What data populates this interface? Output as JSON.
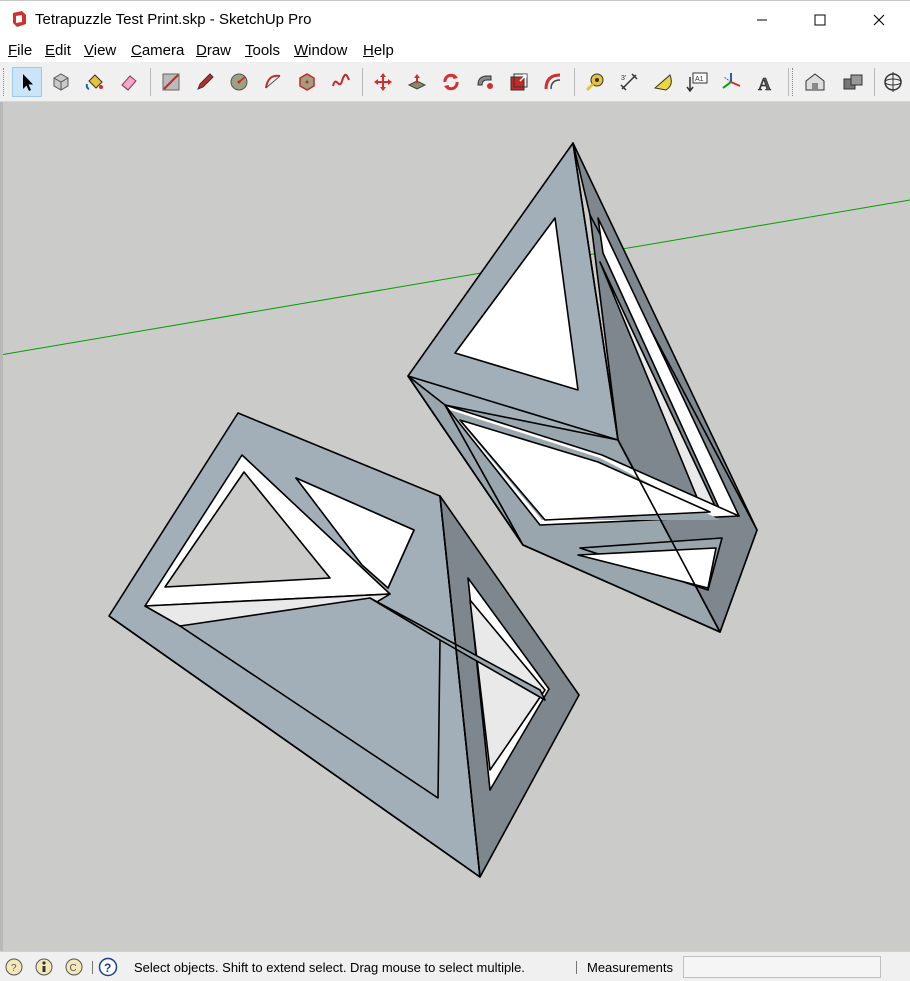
{
  "window": {
    "title": "Tetrapuzzle Test Print.skp - SketchUp Pro",
    "controls": {
      "minimize": "—",
      "maximize": "☐",
      "close": "✕"
    }
  },
  "menu": {
    "items": [
      {
        "label": "File",
        "key": "F",
        "rest": "ile"
      },
      {
        "label": "Edit",
        "key": "E",
        "rest": "dit"
      },
      {
        "label": "View",
        "key": "V",
        "rest": "iew"
      },
      {
        "label": "Camera",
        "key": "C",
        "rest": "amera"
      },
      {
        "label": "Draw",
        "key": "D",
        "rest": "raw"
      },
      {
        "label": "Tools",
        "key": "T",
        "rest": "ools"
      },
      {
        "label": "Window",
        "key": "W",
        "rest": "indow"
      },
      {
        "label": "Help",
        "key": "H",
        "rest": "elp"
      }
    ]
  },
  "toolbar": {
    "tools": [
      {
        "name": "select-tool-icon",
        "active": true
      },
      {
        "name": "make-component-icon"
      },
      {
        "name": "paint-bucket-icon"
      },
      {
        "name": "eraser-icon"
      },
      {
        "name": "line-tool-icon"
      },
      {
        "name": "freehand-pencil-icon"
      },
      {
        "name": "circle-tool-icon"
      },
      {
        "name": "arc-tool-icon"
      },
      {
        "name": "polygon-tool-icon"
      },
      {
        "name": "freehand-curve-icon"
      },
      {
        "name": "move-tool-icon"
      },
      {
        "name": "push-pull-icon"
      },
      {
        "name": "rotate-tool-icon"
      },
      {
        "name": "follow-me-icon"
      },
      {
        "name": "scale-tool-icon"
      },
      {
        "name": "offset-tool-icon"
      },
      {
        "name": "tape-measure-icon"
      },
      {
        "name": "dimension-tool-icon"
      },
      {
        "name": "protractor-icon"
      },
      {
        "name": "text-tool-icon",
        "text": "A1"
      },
      {
        "name": "axes-tool-icon"
      },
      {
        "name": "3d-text-icon",
        "text": "A"
      },
      {
        "name": "3d-warehouse-icon"
      },
      {
        "name": "extension-warehouse-icon"
      },
      {
        "name": "orbit-tool-icon"
      }
    ]
  },
  "colors": {
    "viewport_bg": "#cbcbc9",
    "face_top": "#a2afb8",
    "face_side": "#7e878e",
    "face_light": "#e9e9e9",
    "face_white": "#ffffff",
    "green_axis": "#00a000",
    "edge": "#000000"
  },
  "status": {
    "message": "Select objects. Shift to extend select. Drag mouse to select multiple.",
    "measurements_label": "Measurements",
    "measurements_value": ""
  }
}
